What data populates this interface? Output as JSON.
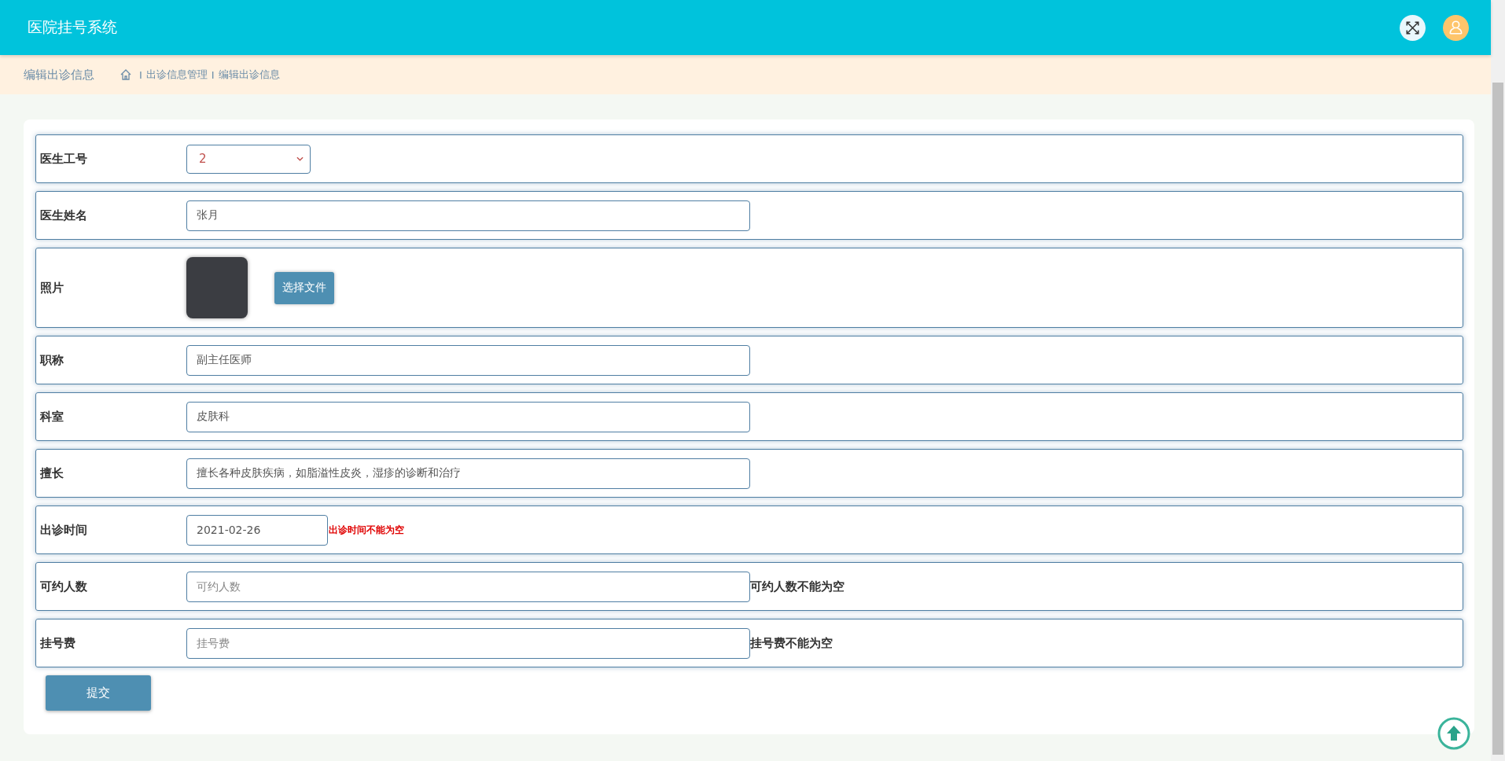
{
  "header": {
    "title": "医院挂号系统"
  },
  "breadcrumb": {
    "page_title": "编辑出诊信息",
    "items": [
      {
        "separator": "I",
        "label": "出诊信息管理"
      },
      {
        "separator": "I",
        "label": "编辑出诊信息"
      }
    ]
  },
  "form": {
    "fields": [
      {
        "kind": "select",
        "label": "医生工号",
        "value": "2"
      },
      {
        "kind": "text",
        "label": "医生姓名",
        "value": "张月"
      },
      {
        "kind": "photo",
        "label": "照片",
        "button": "选择文件"
      },
      {
        "kind": "text",
        "label": "职称",
        "value": "副主任医师"
      },
      {
        "kind": "text",
        "label": "科室",
        "value": "皮肤科"
      },
      {
        "kind": "text",
        "label": "擅长",
        "value": "擅长各种皮肤疾病，如脂溢性皮炎，湿疹的诊断和治疗"
      },
      {
        "kind": "date",
        "label": "出诊时间",
        "value": "2021-02-26",
        "error": "出诊时间不能为空",
        "color": "#e00000"
      },
      {
        "kind": "text",
        "label": "可约人数",
        "placeholder": "可约人数",
        "error": "可约人数不能为空",
        "color": "#333333"
      },
      {
        "kind": "text",
        "label": "挂号费",
        "placeholder": "挂号费",
        "error": "挂号费不能为空",
        "color": "#333333"
      }
    ],
    "submit": "提交"
  }
}
